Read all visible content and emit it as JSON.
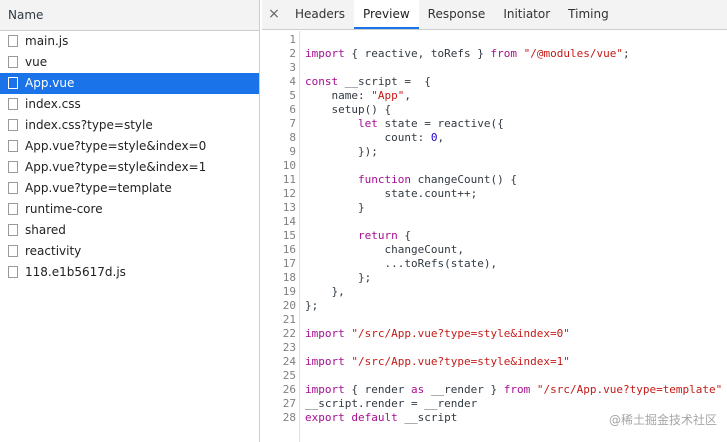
{
  "left_panel": {
    "header": "Name",
    "files": [
      {
        "name": "main.js"
      },
      {
        "name": "vue"
      },
      {
        "name": "App.vue",
        "selected": true
      },
      {
        "name": "index.css"
      },
      {
        "name": "index.css?type=style"
      },
      {
        "name": "App.vue?type=style&index=0"
      },
      {
        "name": "App.vue?type=style&index=1"
      },
      {
        "name": "App.vue?type=template"
      },
      {
        "name": "runtime-core"
      },
      {
        "name": "shared"
      },
      {
        "name": "reactivity"
      },
      {
        "name": "118.e1b5617d.js"
      }
    ]
  },
  "tabs": {
    "close": "×",
    "items": [
      "Headers",
      "Preview",
      "Response",
      "Initiator",
      "Timing"
    ],
    "active": "Preview"
  },
  "code_lines": [
    "",
    "import { reactive, toRefs } from \"/@modules/vue\";",
    "",
    "const __script =  {",
    "    name: \"App\",",
    "    setup() {",
    "        let state = reactive({",
    "            count: 0,",
    "        });",
    "",
    "        function changeCount() {",
    "            state.count++;",
    "        }",
    "",
    "        return {",
    "            changeCount,",
    "            ...toRefs(state),",
    "        };",
    "    },",
    "};",
    "",
    "import \"/src/App.vue?type=style&index=0\"",
    "",
    "import \"/src/App.vue?type=style&index=1\"",
    "",
    "import { render as __render } from \"/src/App.vue?type=template\"",
    "__script.render = __render",
    "export default __script"
  ],
  "watermark": "@稀土掘金技术社区"
}
